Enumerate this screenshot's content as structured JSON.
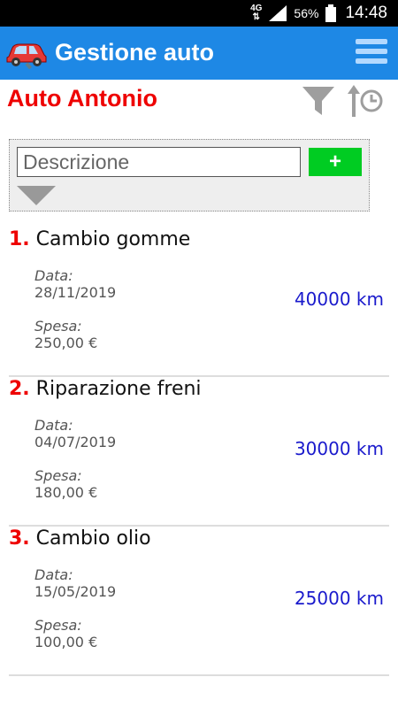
{
  "status_bar": {
    "network": "4G",
    "battery_percent": "56%",
    "clock": "14:48"
  },
  "app_bar": {
    "title": "Gestione auto",
    "logo_icon": "car-wrench-icon",
    "menu_icon": "hamburger-icon",
    "background_color": "#1e88e5"
  },
  "car": {
    "name": "Auto Antonio",
    "filter_icon": "filter-icon",
    "sort_icon": "sort-by-time-icon"
  },
  "add_form": {
    "placeholder": "Descrizione",
    "add_label": "+",
    "add_color": "#00cc22"
  },
  "entries": [
    {
      "number": "1.",
      "title": "Cambio gomme",
      "date_label": "Data:",
      "date": "28/11/2019",
      "cost_label": "Spesa:",
      "cost": "250,00 €",
      "km": "40000 km"
    },
    {
      "number": "2.",
      "title": "Riparazione freni",
      "date_label": "Data:",
      "date": "04/07/2019",
      "cost_label": "Spesa:",
      "cost": "180,00 €",
      "km": "30000 km"
    },
    {
      "number": "3.",
      "title": "Cambio olio",
      "date_label": "Data:",
      "date": "15/05/2019",
      "cost_label": "Spesa:",
      "cost": "100,00 €",
      "km": "25000 km"
    }
  ]
}
